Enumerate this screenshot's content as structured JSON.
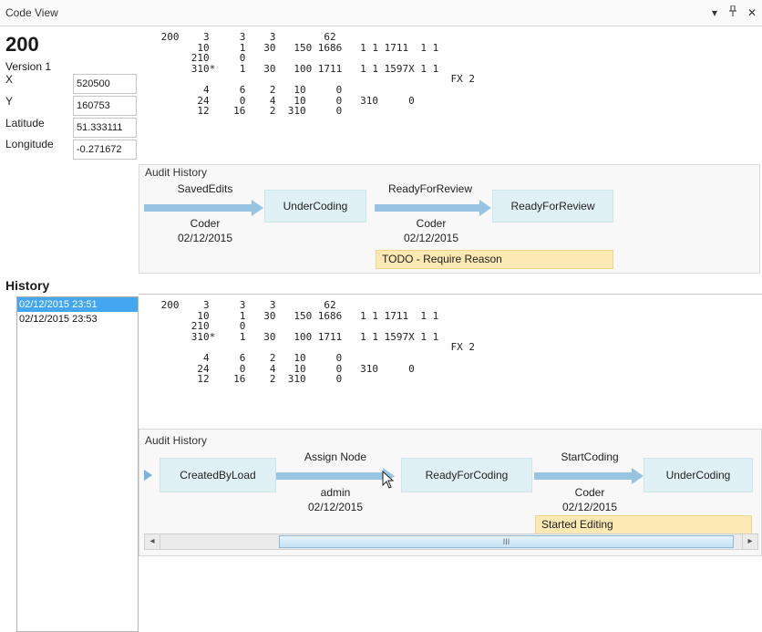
{
  "window": {
    "title": "Code View",
    "controls": [
      {
        "name": "dropdown",
        "glyph": "▾"
      },
      {
        "name": "pin",
        "glyph": "1"
      },
      {
        "name": "close",
        "glyph": "✕"
      }
    ]
  },
  "details": {
    "code": "200",
    "version": "Version 1",
    "fields": [
      {
        "label": "X",
        "value": "520500"
      },
      {
        "label": "Y",
        "value": "160753"
      },
      {
        "label": "Latitude",
        "value": "51.333111"
      },
      {
        "label": "Longitude",
        "value": "-0.271672"
      }
    ]
  },
  "top_code": {
    "lines": [
      " 200    3     3    3        62",
      "       10     1   30   150 1686   1 1 1711  1 1",
      "      210     0",
      "      310*    1   30   100 1711   1 1 1597X 1 1",
      "                                                 FX 2",
      "        4     6    2   10     0",
      "       24     0    4   10     0   310     0",
      "       12    16    2  310     0"
    ]
  },
  "top_audit": {
    "title": "Audit History",
    "transitions": [
      {
        "action": "SavedEdits",
        "user": "Coder",
        "date": "02/12/2015",
        "to": "UnderCoding"
      },
      {
        "action": "ReadyForReview",
        "user": "Coder",
        "date": "02/12/2015",
        "to": "ReadyForReview",
        "note": "TODO - Require Reason"
      }
    ]
  },
  "history": {
    "heading": "History",
    "items": [
      "02/12/2015 23:51",
      "02/12/2015 23:53"
    ],
    "selected_index": 0
  },
  "bottom_code": {
    "lines": [
      " 200    3     3    3        62",
      "       10     1   30   150 1686   1 1 1711  1 1",
      "      210     0",
      "      310*    1   30   100 1711   1 1 1597X 1 1",
      "                                                 FX 2",
      "        4     6    2   10     0",
      "       24     0    4   10     0   310     0",
      "       12    16    2  310     0"
    ]
  },
  "bottom_audit": {
    "title": "Audit History",
    "start_state": "CreatedByLoad",
    "transitions": [
      {
        "action": "Assign Node",
        "user": "admin",
        "date": "02/12/2015",
        "to": "ReadyForCoding"
      },
      {
        "action": "StartCoding",
        "user": "Coder",
        "date": "02/12/2015",
        "to": "UnderCoding",
        "note": "Started Editing"
      }
    ],
    "scrollbar": {
      "left_glyph": "◂",
      "right_glyph": "▸",
      "thumb_glyph": "III",
      "position": 0.5
    }
  }
}
